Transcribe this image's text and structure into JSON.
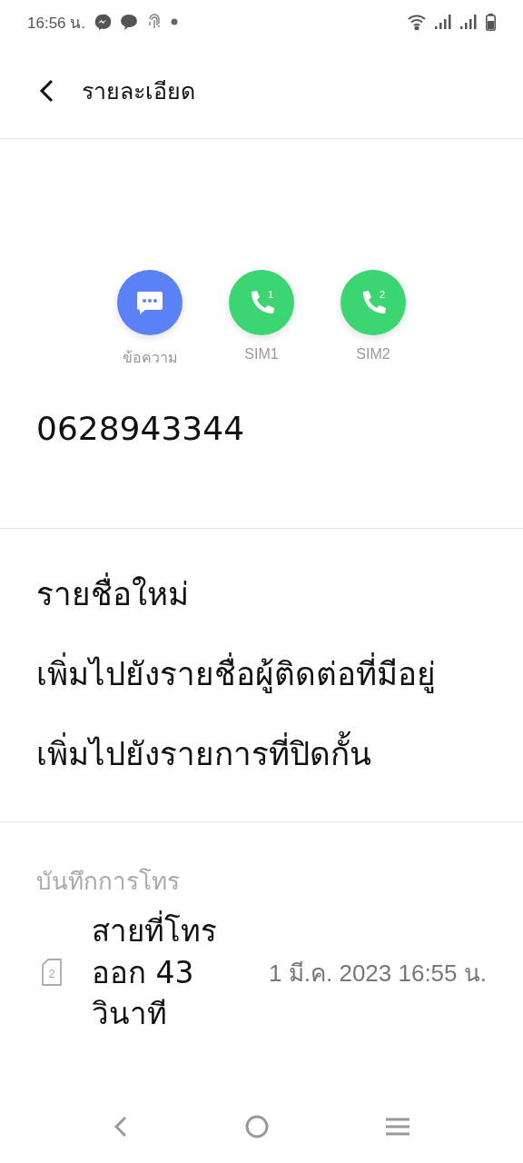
{
  "status_bar": {
    "time": "16:56 น."
  },
  "header": {
    "title": "รายละเอียด"
  },
  "actions": [
    {
      "kind": "message",
      "label": "ข้อความ",
      "color": "#5b82f5"
    },
    {
      "kind": "call",
      "label": "SIM1",
      "badge": "1",
      "color": "#3bd671"
    },
    {
      "kind": "call",
      "label": "SIM2",
      "badge": "2",
      "color": "#3bd671"
    }
  ],
  "phone_number": "0628943344",
  "options": [
    "รายชื่อใหม่",
    "เพิ่มไปยังรายชื่อผู้ติดต่อที่มีอยู่",
    "เพิ่มไปยังรายการที่ปิดกั้น"
  ],
  "call_log": {
    "heading": "บันทึกการโทร",
    "entries": [
      {
        "sim": "2",
        "description": "สายที่โทรออก 43 วินาที",
        "time": "1 มี.ค. 2023 16:55 น."
      }
    ]
  }
}
